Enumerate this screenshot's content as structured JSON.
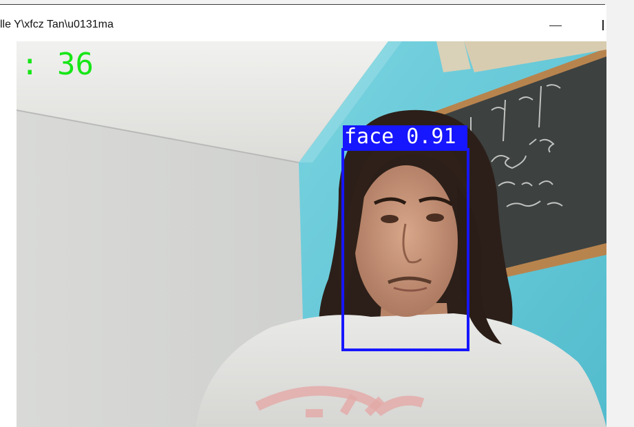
{
  "window": {
    "title": "lle Y\\xfcz Tan\\u0131ma",
    "minimize_label": "—"
  },
  "camera_feed": {
    "fps_text": ": 36",
    "detections": [
      {
        "label": "face 0.91",
        "class": "face",
        "confidence": 0.91
      }
    ]
  },
  "colors": {
    "fps_text": "#16e616",
    "detection_box": "#1616ff",
    "wall_blue": "#58c6d6",
    "wall_white": "#d8d9d8"
  },
  "icons": [
    "minimize-icon",
    "maximize-icon"
  ]
}
